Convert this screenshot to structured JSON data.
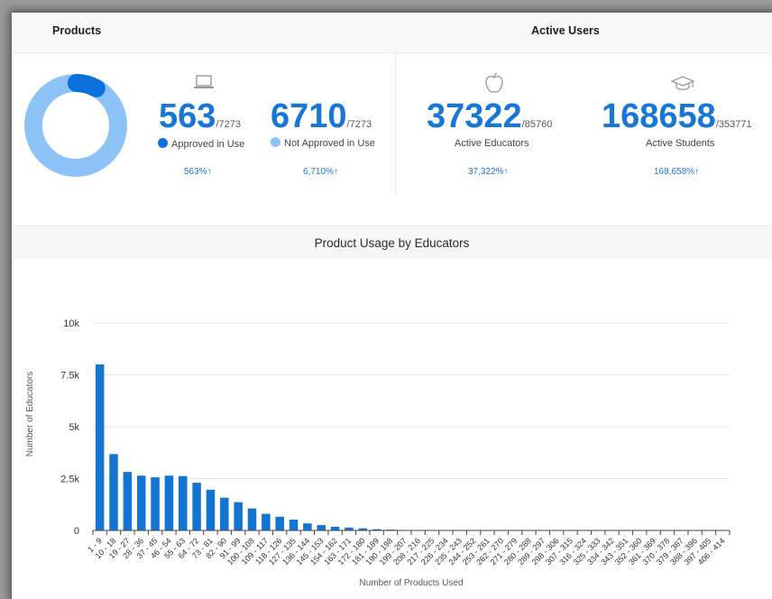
{
  "products": {
    "title": "Products",
    "approved": {
      "value": "563",
      "total": "/7273",
      "label": "Approved in Use",
      "pct": "563%↑",
      "color": "#0b72db"
    },
    "not_approved": {
      "value": "6710",
      "total": "/7273",
      "label": "Not Approved in Use",
      "pct": "6,710%↑",
      "color": "#8dc2f7"
    },
    "icon": "laptop-icon"
  },
  "active_users": {
    "title": "Active Users",
    "educators": {
      "value": "37322",
      "total": "/85760",
      "label": "Active Educators",
      "pct": "37,322%↑",
      "icon": "apple-icon"
    },
    "students": {
      "value": "168658",
      "total": "/353771",
      "label": "Active Students",
      "pct": "168,658%↑",
      "icon": "graduation-cap-icon"
    }
  },
  "chart_panel": {
    "title": "Product Usage by Educators"
  },
  "chart_data": {
    "type": "bar",
    "title": "Product Usage by Educators",
    "xlabel": "Number of Products Used",
    "ylabel": "Number of Educators",
    "ylim": [
      0,
      10000
    ],
    "yticks": [
      0,
      2500,
      5000,
      7500,
      10000
    ],
    "ytick_labels": [
      "0",
      "2.5k",
      "5k",
      "7.5k",
      "10k"
    ],
    "grid": true,
    "bar_color": "#1474d2",
    "categories": [
      "1 - 9",
      "10 - 18",
      "19 - 27",
      "28 - 36",
      "37 - 45",
      "46 - 54",
      "55 - 63",
      "64 - 72",
      "73 - 81",
      "82 - 90",
      "91 - 99",
      "100 - 108",
      "109 - 117",
      "118 - 126",
      "127 - 135",
      "136 - 144",
      "145 - 153",
      "154 - 162",
      "163 - 171",
      "172 - 180",
      "181 - 189",
      "190 - 198",
      "199 - 207",
      "208 - 216",
      "217 - 225",
      "226 - 234",
      "235 - 243",
      "244 - 252",
      "253 - 261",
      "262 - 270",
      "271 - 279",
      "280 - 288",
      "289 - 297",
      "298 - 306",
      "307 - 315",
      "316 - 324",
      "325 - 333",
      "334 - 342",
      "343 - 351",
      "352 - 360",
      "361 - 369",
      "370 - 378",
      "379 - 387",
      "388 - 396",
      "397 - 405",
      "406 - 414"
    ],
    "values": [
      8000,
      3680,
      2820,
      2640,
      2560,
      2640,
      2620,
      2300,
      1960,
      1580,
      1360,
      1060,
      800,
      660,
      520,
      340,
      260,
      180,
      140,
      100,
      60,
      40,
      20,
      10,
      5,
      0,
      0,
      0,
      0,
      0,
      0,
      0,
      0,
      0,
      0,
      0,
      0,
      0,
      0,
      0,
      0,
      0,
      0,
      0,
      0,
      0
    ]
  }
}
